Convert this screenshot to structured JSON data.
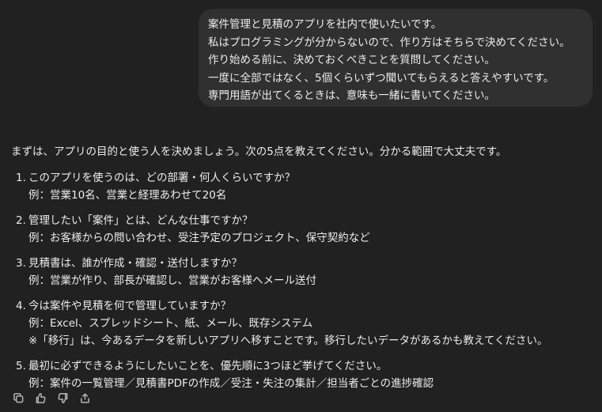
{
  "user_message": {
    "lines": [
      "案件管理と見積のアプリを社内で使いたいです。",
      "私はプログラミングが分からないので、作り方はそちらで決めてください。",
      "作り始める前に、決めておくべきことを質問してください。",
      "一度に全部ではなく、5個くらいずつ聞いてもらえると答えやすいです。",
      "専門用語が出てくるときは、意味も一緒に書いてください。"
    ]
  },
  "assistant_message": {
    "intro": "まずは、アプリの目的と使う人を決めましょう。次の5点を教えてください。分かる範囲で大丈夫です。",
    "questions": [
      {
        "number": "1.",
        "lines": [
          "このアプリを使うのは、どの部署・何人くらいですか？",
          "例：営業10名、営業と経理あわせて20名"
        ]
      },
      {
        "number": "2.",
        "lines": [
          "管理したい「案件」とは、どんな仕事ですか？",
          "例：お客様からの問い合わせ、受注予定のプロジェクト、保守契約など"
        ]
      },
      {
        "number": "3.",
        "lines": [
          "見積書は、誰が作成・確認・送付しますか？",
          "例：営業が作り、部長が確認し、営業がお客様へメール送付"
        ]
      },
      {
        "number": "4.",
        "lines": [
          "今は案件や見積を何で管理していますか？",
          "例：Excel、スプレッドシート、紙、メール、既存システム",
          "※「移行」は、今あるデータを新しいアプリへ移すことです。移行したいデータがあるかも教えてください。"
        ]
      },
      {
        "number": "5.",
        "lines": [
          "最初に必ずできるようにしたいことを、優先順に3つほど挙げてください。",
          "例：案件の一覧管理／見積書PDFの作成／受注・失注の集計／担当者ごとの進捗確認"
        ]
      }
    ]
  },
  "actions": {
    "icons": [
      "copy-icon",
      "thumbs-up-icon",
      "thumbs-down-icon",
      "share-icon"
    ]
  },
  "colors": {
    "background": "#212121",
    "bubble": "#303030",
    "text": "#ececec",
    "icon": "#b4b4b4"
  }
}
